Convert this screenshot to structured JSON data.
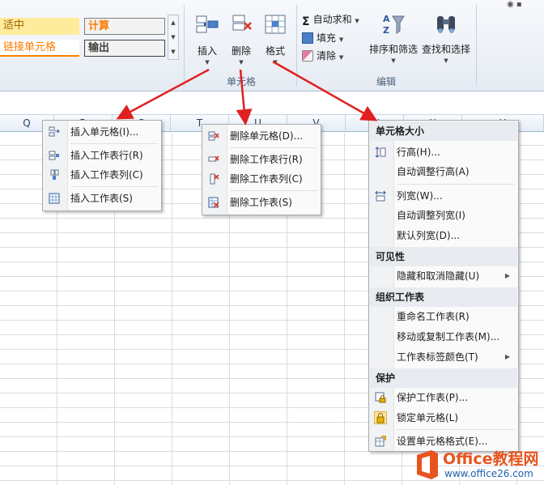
{
  "ribbon": {
    "styles": {
      "neutral": "适中",
      "calc": "计算",
      "link": "链接单元格",
      "output": "输出"
    },
    "cells_group": {
      "insert": "插入",
      "delete": "删除",
      "format": "格式",
      "label": "单元格"
    },
    "editing_group": {
      "autosum": "自动求和",
      "fill": "填充",
      "clear": "清除",
      "sort": "排序和筛选",
      "find": "查找和选择",
      "label": "编辑"
    }
  },
  "columns": [
    "Q",
    "R",
    "S",
    "T",
    "U",
    "V",
    "W",
    "X",
    "Y"
  ],
  "insert_menu": [
    {
      "label": "插入单元格(I)..."
    },
    {
      "label": "插入工作表行(R)"
    },
    {
      "label": "插入工作表列(C)"
    },
    {
      "label": "插入工作表(S)"
    }
  ],
  "delete_menu": [
    {
      "label": "删除单元格(D)..."
    },
    {
      "label": "删除工作表行(R)"
    },
    {
      "label": "删除工作表列(C)"
    },
    {
      "label": "删除工作表(S)"
    }
  ],
  "format_menu": {
    "size_header": "单元格大小",
    "row_height": "行高(H)...",
    "autofit_row": "自动调整行高(A)",
    "col_width": "列宽(W)...",
    "autofit_col": "自动调整列宽(I)",
    "default_width": "默认列宽(D)...",
    "visibility_header": "可见性",
    "hide_unhide": "隐藏和取消隐藏(U)",
    "organize_header": "组织工作表",
    "rename": "重命名工作表(R)",
    "move_copy": "移动或复制工作表(M)...",
    "tab_color": "工作表标签颜色(T)",
    "protect_header": "保护",
    "protect_sheet": "保护工作表(P)...",
    "lock_cell": "锁定单元格(L)",
    "format_cells": "设置单元格格式(E)..."
  },
  "watermark": {
    "brand": "Office教程网",
    "url": "www.office26.com"
  },
  "colors": {
    "arrow": "#e02020",
    "menu_header_bg": "#e8ecf1",
    "ribbon_bg": "#e6ebf3"
  }
}
